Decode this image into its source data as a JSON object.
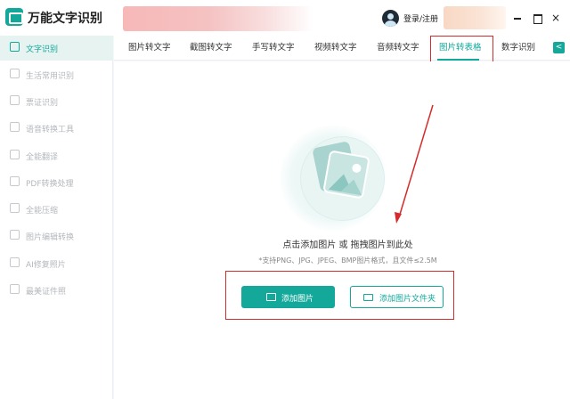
{
  "app": {
    "title": "万能文字识别"
  },
  "header": {
    "login_label": "登录/注册"
  },
  "window_controls": {
    "close_glyph": "×"
  },
  "sidebar": {
    "items": [
      {
        "label": "文字识别",
        "active": true
      },
      {
        "label": "生活常用识别"
      },
      {
        "label": "票证识别"
      },
      {
        "label": "语音转换工具"
      },
      {
        "label": "全能翻译"
      },
      {
        "label": "PDF转换处理"
      },
      {
        "label": "全能压缩"
      },
      {
        "label": "图片编辑转换"
      },
      {
        "label": "AI修复照片"
      },
      {
        "label": "最美证件照"
      }
    ]
  },
  "tabs": [
    {
      "label": "图片转文字"
    },
    {
      "label": "截图转文字"
    },
    {
      "label": "手写转文字"
    },
    {
      "label": "视频转文字"
    },
    {
      "label": "音频转文字"
    },
    {
      "label": "图片转表格",
      "active": true
    },
    {
      "label": "数字识别"
    }
  ],
  "tab_next_glyph": "<",
  "dropzone": {
    "title": "点击添加图片 或 拖拽图片到此处",
    "subtitle": "*支持PNG、JPG、JPEG、BMP图片格式，且文件≤2.5M"
  },
  "buttons": {
    "add_image": "添加图片",
    "add_folder": "添加图片文件夹"
  },
  "colors": {
    "accent": "#13a89a",
    "annotation_red": "#d62b2b"
  }
}
